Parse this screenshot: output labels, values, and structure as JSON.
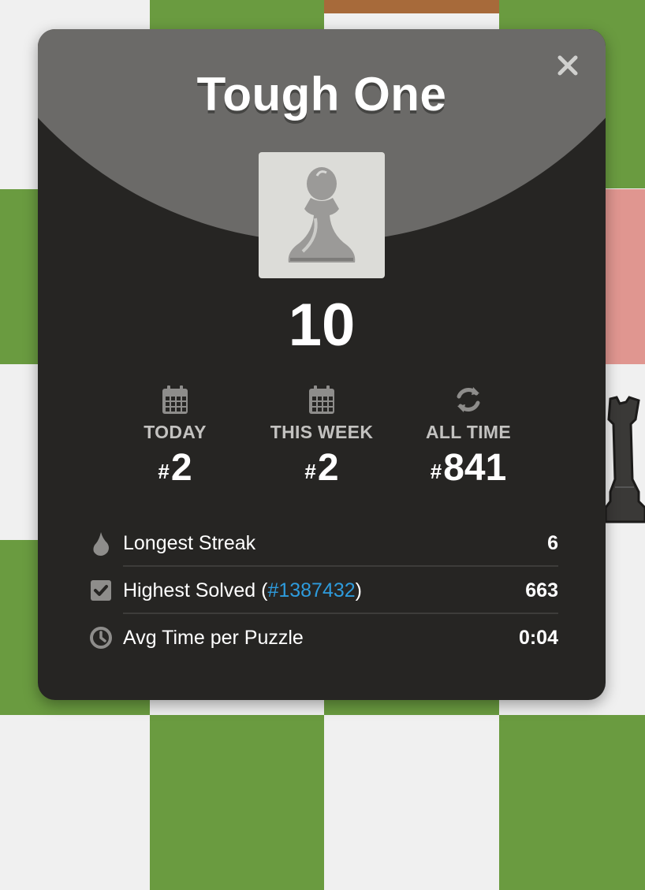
{
  "colors": {
    "board_light": "#f0f0f0",
    "board_dark": "#6a9b40",
    "board_highlight": "#e09690",
    "board_brown": "#a76a3a",
    "modal_bg": "#262523",
    "header_bg": "#6b6a68",
    "link": "#2e9bdc"
  },
  "modal": {
    "title": "Tough One",
    "close_icon": "close-icon",
    "piece_icon": "pawn-icon",
    "score": "10"
  },
  "ranks": [
    {
      "icon": "calendar-icon",
      "label": "TODAY",
      "hash": "#",
      "value": "2"
    },
    {
      "icon": "calendar-icon",
      "label": "THIS WEEK",
      "hash": "#",
      "value": "2"
    },
    {
      "icon": "refresh-icon",
      "label": "ALL TIME",
      "hash": "#",
      "value": "841"
    }
  ],
  "stats": {
    "streak": {
      "icon": "flame-icon",
      "label": "Longest Streak",
      "value": "6"
    },
    "highest": {
      "icon": "checkbox-icon",
      "label_prefix": "Highest Solved (",
      "link": "#1387432",
      "label_suffix": ")",
      "value": "663"
    },
    "avg_time": {
      "icon": "clock-icon",
      "label": "Avg Time per Puzzle",
      "value": "0:04"
    }
  }
}
